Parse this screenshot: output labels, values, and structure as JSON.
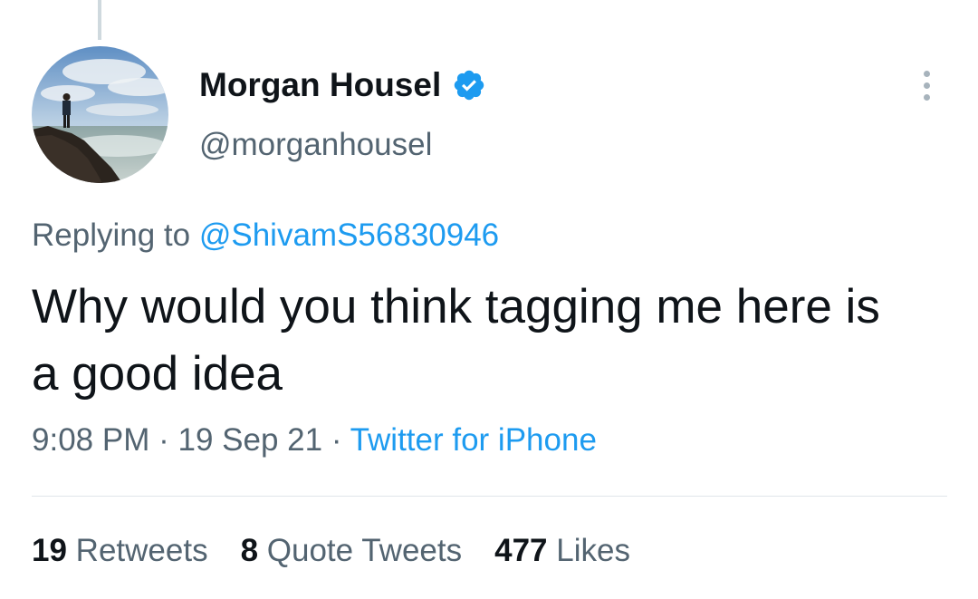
{
  "author": {
    "display_name": "Morgan Housel",
    "handle": "@morganhousel",
    "verified_icon": "verified-badge-icon",
    "avatar_icon": "profile-photo"
  },
  "reply": {
    "prefix": "Replying to",
    "mention": "@ShivamS56830946"
  },
  "tweet": {
    "text": "Why would you think tagging me here is a good idea"
  },
  "meta": {
    "time": "9:08 PM",
    "separator": "·",
    "date": "19 Sep 21",
    "source": "Twitter for iPhone"
  },
  "stats": {
    "retweets_count": "19",
    "retweets_label": "Retweets",
    "quotes_count": "8",
    "quotes_label": "Quote Tweets",
    "likes_count": "477",
    "likes_label": "Likes"
  },
  "colors": {
    "link_blue": "#1d9bf0",
    "text_primary": "#0f1419",
    "text_secondary": "#536471",
    "thread_line": "#cfd9de"
  },
  "icons": {
    "more": "more-dots-icon"
  }
}
